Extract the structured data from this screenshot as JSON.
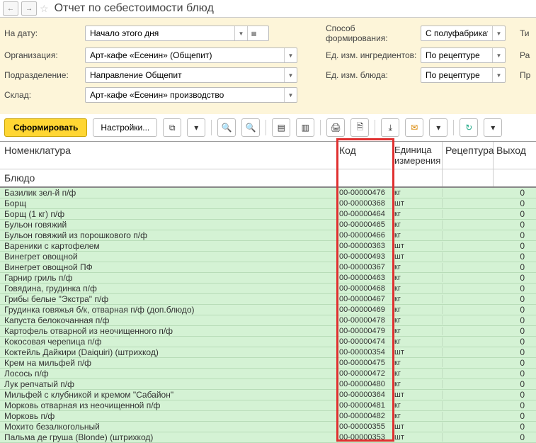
{
  "header": {
    "title": "Отчет по себестоимости блюд"
  },
  "filters": {
    "labels": {
      "date": "На дату:",
      "org": "Организация:",
      "dept": "Подразделение:",
      "warehouse": "Склад:",
      "method": "Способ формирования:",
      "ing_unit": "Ед. изм. ингредиентов:",
      "dish_unit": "Ед. изм. блюда:"
    },
    "values": {
      "date": "Начало этого дня",
      "org": "Арт-кафе «Есенин» (Общепит)",
      "dept": "Направление Общепит",
      "warehouse": "Арт-кафе «Есенин» производство",
      "method": "С полуфабрикатами",
      "ing_unit": "По рецептуре",
      "dish_unit": "По рецептуре"
    },
    "edge_labels": {
      "r1": "Ти",
      "r2": "Ра",
      "r3": "Пр"
    }
  },
  "toolbar": {
    "generate": "Сформировать",
    "settings": "Настройки..."
  },
  "grid": {
    "headers": {
      "nomenclature": "Номенклатура",
      "code": "Код",
      "unit": "Единица измерения",
      "recipe": "Рецептура",
      "output": "Выход",
      "dish": "Блюдо"
    },
    "rows": [
      {
        "name": "Базилик зел-й п/ф",
        "code": "00-00000476",
        "unit": "кг",
        "out": "0"
      },
      {
        "name": "Борщ",
        "code": "00-00000368",
        "unit": "шт",
        "out": "0"
      },
      {
        "name": "Борщ (1 кг) п/ф",
        "code": "00-00000464",
        "unit": "кг",
        "out": "0"
      },
      {
        "name": "Бульон говяжий",
        "code": "00-00000465",
        "unit": "кг",
        "out": "0"
      },
      {
        "name": "Бульон говяжий из порошкового п/ф",
        "code": "00-00000466",
        "unit": "кг",
        "out": "0"
      },
      {
        "name": "Вареники с картофелем",
        "code": "00-00000363",
        "unit": "шт",
        "out": "0"
      },
      {
        "name": "Винегрет овощной",
        "code": "00-00000493",
        "unit": "шт",
        "out": "0"
      },
      {
        "name": "Винегрет овощной ПФ",
        "code": "00-00000367",
        "unit": "кг",
        "out": "0"
      },
      {
        "name": "Гарнир гриль п/ф",
        "code": "00-00000463",
        "unit": "кг",
        "out": "0"
      },
      {
        "name": "Говядина, грудинка п/ф",
        "code": "00-00000468",
        "unit": "кг",
        "out": "0"
      },
      {
        "name": "Грибы белые \"Экстра\" п/ф",
        "code": "00-00000467",
        "unit": "кг",
        "out": "0"
      },
      {
        "name": "Грудинка говяжья б/к, отварная п/ф (доп.блюдо)",
        "code": "00-00000469",
        "unit": "кг",
        "out": "0"
      },
      {
        "name": "Капуста белокочанная п/ф",
        "code": "00-00000478",
        "unit": "кг",
        "out": "0"
      },
      {
        "name": "Картофель отварной из неочищенного п/ф",
        "code": "00-00000479",
        "unit": "кг",
        "out": "0"
      },
      {
        "name": "Кокосовая черепица п/ф",
        "code": "00-00000474",
        "unit": "кг",
        "out": "0"
      },
      {
        "name": "Коктейль Дайкири (Daiquiri) (штрихкод)",
        "code": "00-00000354",
        "unit": "шт",
        "out": "0"
      },
      {
        "name": "Крем на мильфей п/ф",
        "code": "00-00000475",
        "unit": "кг",
        "out": "0"
      },
      {
        "name": "Лосось п/ф",
        "code": "00-00000472",
        "unit": "кг",
        "out": "0"
      },
      {
        "name": "Лук репчатый п/ф",
        "code": "00-00000480",
        "unit": "кг",
        "out": "0"
      },
      {
        "name": "Мильфей с клубникой и кремом \"Сабайон\"",
        "code": "00-00000364",
        "unit": "шт",
        "out": "0"
      },
      {
        "name": "Морковь отварная из неочищенной п/ф",
        "code": "00-00000481",
        "unit": "кг",
        "out": "0"
      },
      {
        "name": "Морковь п/ф",
        "code": "00-00000482",
        "unit": "кг",
        "out": "0"
      },
      {
        "name": "Мохито безалкогольный",
        "code": "00-00000355",
        "unit": "шт",
        "out": "0"
      },
      {
        "name": "Пальма де груша (Blonde) (штрихкод)",
        "code": "00-00000353",
        "unit": "шт",
        "out": "0"
      }
    ]
  }
}
